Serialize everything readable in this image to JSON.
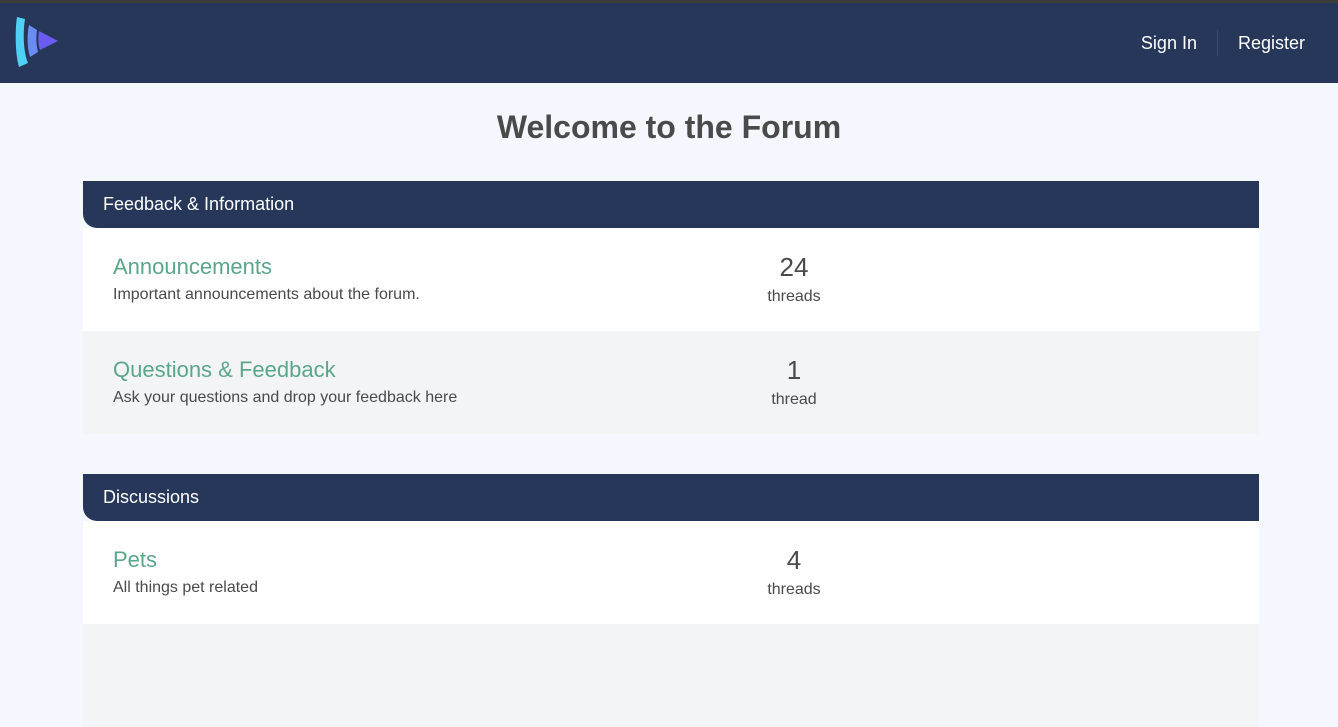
{
  "nav": {
    "logo_icon": "play-logo-icon",
    "sign_in_label": "Sign In",
    "register_label": "Register"
  },
  "page": {
    "title": "Welcome to the Forum"
  },
  "sections": [
    {
      "title": "Feedback & Information",
      "forums": [
        {
          "name": "Announcements",
          "description": "Important announcements about the forum.",
          "count": "24",
          "count_label": "threads"
        },
        {
          "name": "Questions & Feedback",
          "description": "Ask your questions and drop your feedback here",
          "count": "1",
          "count_label": "thread"
        }
      ]
    },
    {
      "title": "Discussions",
      "forums": [
        {
          "name": "Pets",
          "description": "All things pet related",
          "count": "4",
          "count_label": "threads"
        },
        {
          "name": "",
          "description": "",
          "count": "",
          "count_label": ""
        }
      ]
    }
  ],
  "colors": {
    "navbar": "#263759",
    "forum_link": "#5aa68a",
    "background": "#f4f7fd"
  }
}
